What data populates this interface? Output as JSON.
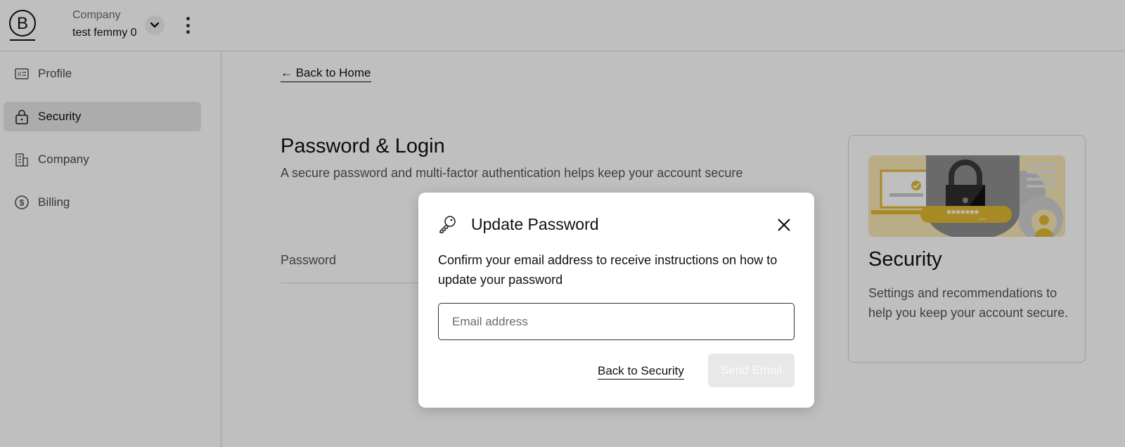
{
  "header": {
    "company_label": "Company",
    "company_name": "test femmy 0"
  },
  "sidebar": {
    "items": [
      {
        "label": "Profile",
        "icon": "id-card-icon"
      },
      {
        "label": "Security",
        "icon": "lock-icon",
        "active": true
      },
      {
        "label": "Company",
        "icon": "building-icon"
      },
      {
        "label": "Billing",
        "icon": "dollar-circle-icon"
      }
    ]
  },
  "main": {
    "back_link": "← Back to Home",
    "title": "Password & Login",
    "subtitle": "A secure password and multi-factor authentication helps keep your account secure",
    "password_label": "Password"
  },
  "security_card": {
    "title": "Security",
    "text": "Settings and recommendations to help you keep your account secure.",
    "illustration_password_text": "*******_"
  },
  "modal": {
    "title": "Update Password",
    "description": "Confirm your email address to receive instructions on how to update your password",
    "email_placeholder": "Email address",
    "email_value": "",
    "back_button": "Back to Security",
    "send_button": "Send Email"
  },
  "colors": {
    "overlay": "rgba(0,0,0,0.25)",
    "illustration_yellow": "#e9c544",
    "illustration_gray": "#8e8e8e"
  }
}
